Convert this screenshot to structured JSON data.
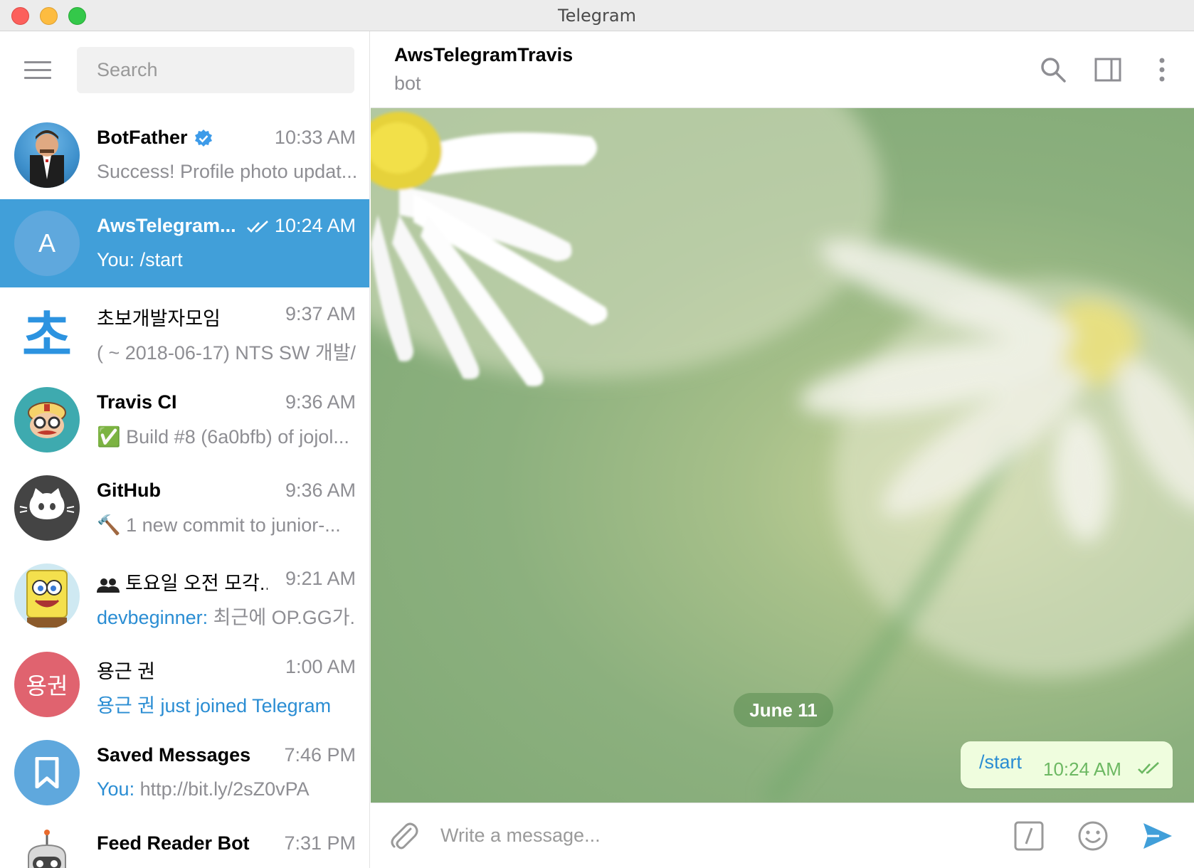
{
  "window": {
    "title": "Telegram"
  },
  "sidebar": {
    "search_placeholder": "Search",
    "chats": [
      {
        "name": "BotFather",
        "time": "10:33 AM",
        "preview": "Success! Profile photo updat...",
        "avatar": "botfather-avatar",
        "verified": true
      },
      {
        "name": "AwsTelegram...",
        "time": "10:24 AM",
        "preview": "You: /start",
        "avatar_letter": "A",
        "active": true,
        "read": true
      },
      {
        "name": "초보개발자모임",
        "time": "9:37 AM",
        "preview": "( ~ 2018-06-17) NTS SW 개발/...",
        "avatar_letter": "초"
      },
      {
        "name": "Travis CI",
        "time": "9:36 AM",
        "preview_icon": "✅",
        "preview": "Build #8 (6a0bfb) of jojol...",
        "avatar": "travis-avatar"
      },
      {
        "name": "GitHub",
        "time": "9:36 AM",
        "preview_icon": "🔨",
        "preview": "1 new commit to junior-...",
        "avatar": "github-avatar"
      },
      {
        "name": "토요일 오전 모각...",
        "time": "9:21 AM",
        "sender": "devbeginner:",
        "preview": "최근에 OP.GG가...",
        "avatar": "spongebob-avatar",
        "group": true
      },
      {
        "name": "용근 권",
        "time": "1:00 AM",
        "preview": "용근 권 just joined Telegram",
        "avatar_letter": "용권"
      },
      {
        "name": "Saved Messages",
        "time": "7:46 PM",
        "sender": "You:",
        "preview": "http://bit.ly/2sZ0vPA",
        "avatar": "bookmark-icon"
      },
      {
        "name": "Feed Reader Bot",
        "time": "7:31 PM",
        "avatar": "robot-avatar"
      }
    ]
  },
  "chat": {
    "peer_name": "AwsTelegramTravis",
    "peer_status": "bot",
    "date_divider": "June 11",
    "messages": [
      {
        "text": "/start",
        "time": "10:24 AM",
        "outgoing": true,
        "read": true
      }
    ],
    "input_placeholder": "Write a message..."
  },
  "colors": {
    "accent": "#419fd9",
    "link": "#2a8dd3",
    "bubble_out": "#effdde",
    "check": "#6cb862"
  }
}
